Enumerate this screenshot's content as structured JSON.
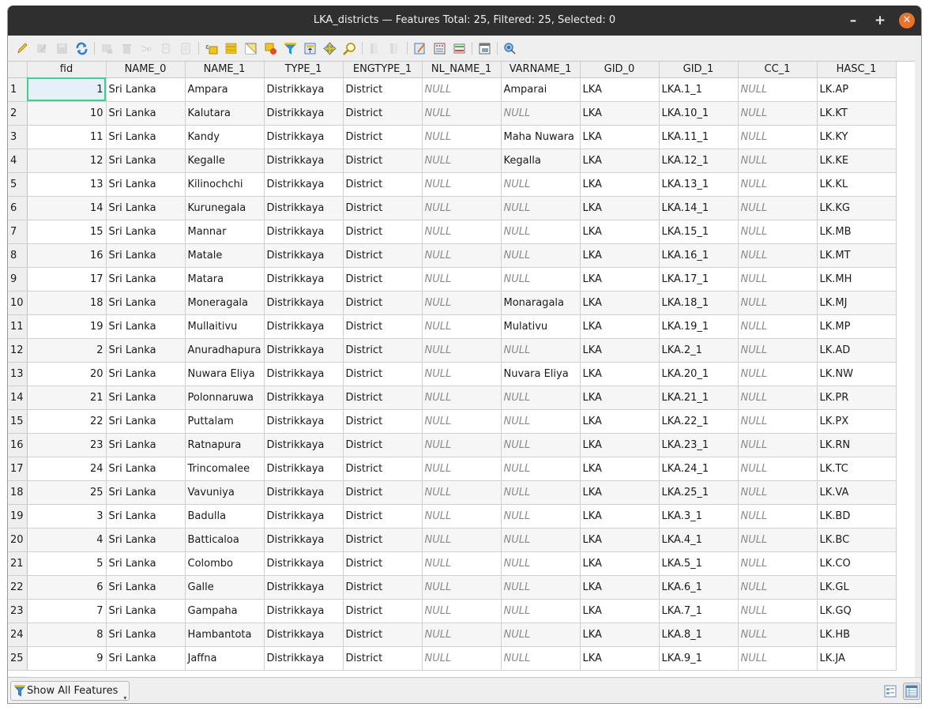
{
  "window": {
    "title": "LKA_districts — Features Total: 25, Filtered: 25, Selected: 0",
    "minimize_label": "–",
    "maximize_label": "+",
    "close_label": "✕"
  },
  "toolbar": {
    "buttons": [
      {
        "name": "toggle-editing",
        "icon": "pencil-icon",
        "enabled": true
      },
      {
        "name": "toggle-multi-edit",
        "icon": "multi-edit-icon",
        "enabled": false
      },
      {
        "name": "save-edits",
        "icon": "save-icon",
        "enabled": false
      },
      {
        "name": "reload-table",
        "icon": "refresh-icon",
        "enabled": true
      },
      {
        "name": "add-feature",
        "icon": "add-feature-icon",
        "enabled": false
      },
      {
        "name": "delete-selected",
        "icon": "trash-icon",
        "enabled": false
      },
      {
        "name": "cut-features",
        "icon": "scissors-icon",
        "enabled": false
      },
      {
        "name": "copy-features",
        "icon": "copy-icon",
        "enabled": false
      },
      {
        "name": "paste-features",
        "icon": "paste-icon",
        "enabled": false
      },
      {
        "name": "select-by-expression",
        "icon": "expression-select-icon",
        "enabled": true
      },
      {
        "name": "select-all",
        "icon": "select-all-icon",
        "enabled": true
      },
      {
        "name": "invert-selection",
        "icon": "invert-selection-icon",
        "enabled": true
      },
      {
        "name": "deselect-all",
        "icon": "deselect-icon",
        "enabled": true
      },
      {
        "name": "filter-select",
        "icon": "filter-icon",
        "enabled": true
      },
      {
        "name": "move-selection-top",
        "icon": "move-top-icon",
        "enabled": true
      },
      {
        "name": "pan-to-selected",
        "icon": "pan-icon",
        "enabled": true
      },
      {
        "name": "zoom-to-selected",
        "icon": "zoom-icon",
        "enabled": true
      },
      {
        "name": "new-field",
        "icon": "new-field-icon",
        "enabled": false
      },
      {
        "name": "delete-field",
        "icon": "delete-field-icon",
        "enabled": false
      },
      {
        "name": "organize-columns",
        "icon": "edit-columns-icon",
        "enabled": true
      },
      {
        "name": "field-calculator",
        "icon": "calculator-icon",
        "enabled": true
      },
      {
        "name": "conditional-formatting",
        "icon": "conditional-format-icon",
        "enabled": true
      },
      {
        "name": "dock-table",
        "icon": "dock-icon",
        "enabled": true
      },
      {
        "name": "actions",
        "icon": "actions-icon",
        "enabled": true
      }
    ]
  },
  "table": {
    "columns": [
      "fid",
      "NAME_0",
      "NAME_1",
      "TYPE_1",
      "ENGTYPE_1",
      "NL_NAME_1",
      "VARNAME_1",
      "GID_0",
      "GID_1",
      "CC_1",
      "HASC_1"
    ],
    "null_text": "NULL",
    "selected_cell": {
      "row": 0,
      "col": 0
    },
    "rows": [
      [
        "1",
        "Sri Lanka",
        "Ampara",
        "Distrikkaya",
        "District",
        null,
        "Amparai",
        "LKA",
        "LKA.1_1",
        null,
        "LK.AP"
      ],
      [
        "10",
        "Sri Lanka",
        "Kalutara",
        "Distrikkaya",
        "District",
        null,
        null,
        "LKA",
        "LKA.10_1",
        null,
        "LK.KT"
      ],
      [
        "11",
        "Sri Lanka",
        "Kandy",
        "Distrikkaya",
        "District",
        null,
        "Maha Nuwara",
        "LKA",
        "LKA.11_1",
        null,
        "LK.KY"
      ],
      [
        "12",
        "Sri Lanka",
        "Kegalle",
        "Distrikkaya",
        "District",
        null,
        "Kegalla",
        "LKA",
        "LKA.12_1",
        null,
        "LK.KE"
      ],
      [
        "13",
        "Sri Lanka",
        "Kilinochchi",
        "Distrikkaya",
        "District",
        null,
        null,
        "LKA",
        "LKA.13_1",
        null,
        "LK.KL"
      ],
      [
        "14",
        "Sri Lanka",
        "Kurunegala",
        "Distrikkaya",
        "District",
        null,
        null,
        "LKA",
        "LKA.14_1",
        null,
        "LK.KG"
      ],
      [
        "15",
        "Sri Lanka",
        "Mannar",
        "Distrikkaya",
        "District",
        null,
        null,
        "LKA",
        "LKA.15_1",
        null,
        "LK.MB"
      ],
      [
        "16",
        "Sri Lanka",
        "Matale",
        "Distrikkaya",
        "District",
        null,
        null,
        "LKA",
        "LKA.16_1",
        null,
        "LK.MT"
      ],
      [
        "17",
        "Sri Lanka",
        "Matara",
        "Distrikkaya",
        "District",
        null,
        null,
        "LKA",
        "LKA.17_1",
        null,
        "LK.MH"
      ],
      [
        "18",
        "Sri Lanka",
        "Moneragala",
        "Distrikkaya",
        "District",
        null,
        "Monaragala",
        "LKA",
        "LKA.18_1",
        null,
        "LK.MJ"
      ],
      [
        "19",
        "Sri Lanka",
        "Mullaitivu",
        "Distrikkaya",
        "District",
        null,
        "Mulativu",
        "LKA",
        "LKA.19_1",
        null,
        "LK.MP"
      ],
      [
        "2",
        "Sri Lanka",
        "Anuradhapura",
        "Distrikkaya",
        "District",
        null,
        null,
        "LKA",
        "LKA.2_1",
        null,
        "LK.AD"
      ],
      [
        "20",
        "Sri Lanka",
        "Nuwara Eliya",
        "Distrikkaya",
        "District",
        null,
        "Nuvara Eliya",
        "LKA",
        "LKA.20_1",
        null,
        "LK.NW"
      ],
      [
        "21",
        "Sri Lanka",
        "Polonnaruwa",
        "Distrikkaya",
        "District",
        null,
        null,
        "LKA",
        "LKA.21_1",
        null,
        "LK.PR"
      ],
      [
        "22",
        "Sri Lanka",
        "Puttalam",
        "Distrikkaya",
        "District",
        null,
        null,
        "LKA",
        "LKA.22_1",
        null,
        "LK.PX"
      ],
      [
        "23",
        "Sri Lanka",
        "Ratnapura",
        "Distrikkaya",
        "District",
        null,
        null,
        "LKA",
        "LKA.23_1",
        null,
        "LK.RN"
      ],
      [
        "24",
        "Sri Lanka",
        "Trincomalee",
        "Distrikkaya",
        "District",
        null,
        null,
        "LKA",
        "LKA.24_1",
        null,
        "LK.TC"
      ],
      [
        "25",
        "Sri Lanka",
        "Vavuniya",
        "Distrikkaya",
        "District",
        null,
        null,
        "LKA",
        "LKA.25_1",
        null,
        "LK.VA"
      ],
      [
        "3",
        "Sri Lanka",
        "Badulla",
        "Distrikkaya",
        "District",
        null,
        null,
        "LKA",
        "LKA.3_1",
        null,
        "LK.BD"
      ],
      [
        "4",
        "Sri Lanka",
        "Batticaloa",
        "Distrikkaya",
        "District",
        null,
        null,
        "LKA",
        "LKA.4_1",
        null,
        "LK.BC"
      ],
      [
        "5",
        "Sri Lanka",
        "Colombo",
        "Distrikkaya",
        "District",
        null,
        null,
        "LKA",
        "LKA.5_1",
        null,
        "LK.CO"
      ],
      [
        "6",
        "Sri Lanka",
        "Galle",
        "Distrikkaya",
        "District",
        null,
        null,
        "LKA",
        "LKA.6_1",
        null,
        "LK.GL"
      ],
      [
        "7",
        "Sri Lanka",
        "Gampaha",
        "Distrikkaya",
        "District",
        null,
        null,
        "LKA",
        "LKA.7_1",
        null,
        "LK.GQ"
      ],
      [
        "8",
        "Sri Lanka",
        "Hambantota",
        "Distrikkaya",
        "District",
        null,
        null,
        "LKA",
        "LKA.8_1",
        null,
        "LK.HB"
      ],
      [
        "9",
        "Sri Lanka",
        "Jaffna",
        "Distrikkaya",
        "District",
        null,
        null,
        "LKA",
        "LKA.9_1",
        null,
        "LK.JA"
      ]
    ]
  },
  "bottombar": {
    "filter_label": "Show All Features",
    "filter_icon": "filter-icon",
    "form_view_icon": "form-view-icon",
    "table_view_icon": "table-view-icon",
    "active_view": "table"
  },
  "colors": {
    "selection_outline": "#3bd38a",
    "selection_fill": "#e6f0f9",
    "close_button": "#e9732a",
    "titlebar": "#2f2f2f",
    "null_text": "#8a8a8a"
  }
}
